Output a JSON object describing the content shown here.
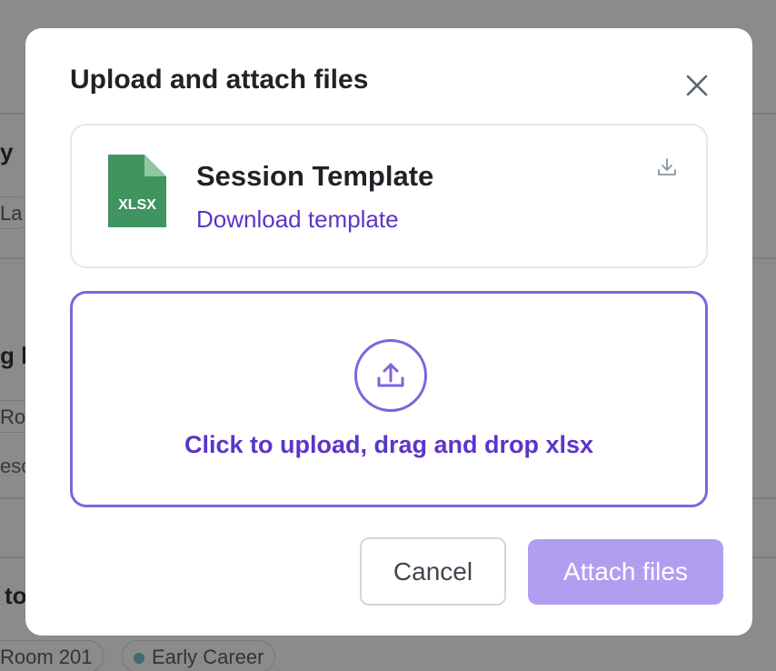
{
  "background": {
    "fragments": [
      "y",
      "La",
      "g l",
      "Roo",
      "esc",
      "to"
    ],
    "chips": [
      "Room 201",
      "Early Career"
    ]
  },
  "modal": {
    "title": "Upload and attach files",
    "close_icon": "close-icon",
    "template": {
      "file_type": "XLSX",
      "file_name": "Session Template",
      "download_link": "Download template",
      "download_icon": "download-icon"
    },
    "dropzone": {
      "icon": "upload-icon",
      "text": "Click to upload, drag and drop xlsx"
    },
    "buttons": {
      "cancel": "Cancel",
      "attach": "Attach files"
    }
  },
  "colors": {
    "accent": "#5b35c9",
    "dropzone_border": "#8163dc",
    "attach_disabled": "#b19ef0",
    "xlsx_green": "#3f9460"
  }
}
